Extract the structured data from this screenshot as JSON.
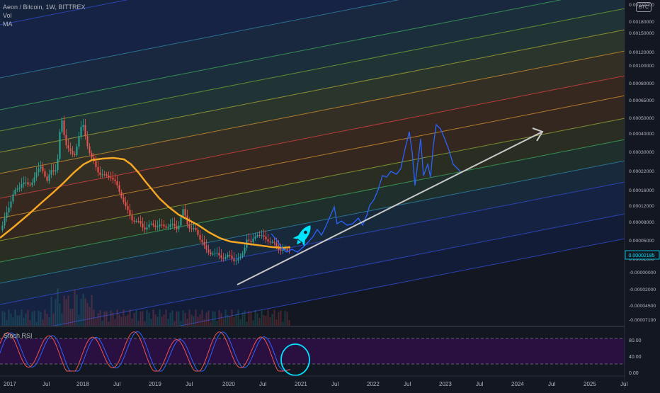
{
  "legend": {
    "symbol_line": "Aeon / Bitcoin, 1W, BITTREX",
    "vol_label": "Vol",
    "ma_label": "MA"
  },
  "currency_badge": "BTC",
  "price_axis": {
    "labels": [
      "0.00220000",
      "0.00180000",
      "0.00150000",
      "0.00120000",
      "0.00100000",
      "0.00080000",
      "0.00065000",
      "0.00050000",
      "0.00040000",
      "0.00030000",
      "0.00022000",
      "0.00016000",
      "0.00012000",
      "0.00008000",
      "0.00005000",
      "0.00002000",
      "-0.00000000",
      "-0.00002000",
      "-0.00004500",
      "-0.00007100"
    ],
    "current_price": "0.00002185",
    "current_price_color": "#00bcd4"
  },
  "oscillator": {
    "label": "Stoch RSI",
    "levels": [
      "80.00",
      "40.00",
      "0.00"
    ],
    "band_color": "#2a1040"
  },
  "time_axis": {
    "labels": [
      "2017",
      "Jul",
      "2018",
      "Jul",
      "2019",
      "Jul",
      "2020",
      "Jul",
      "2021",
      "Jul",
      "2022",
      "Jul",
      "2023",
      "Jul",
      "2024",
      "Jul",
      "2025",
      "Jul"
    ]
  },
  "colors": {
    "background": "#131722",
    "up_candle": "#26a69a",
    "down_candle": "#ef5350",
    "moving_average": "#f5a623",
    "projection": "#2962ff",
    "trend_arrow": "#c8c8c8",
    "rocket": "#00e5ff",
    "stoch_k": "#2962ff",
    "stoch_d": "#ef5350"
  },
  "icons": {
    "rocket": "rocket-icon",
    "circle": "circle-annotation",
    "arrow": "trend-arrow"
  }
}
